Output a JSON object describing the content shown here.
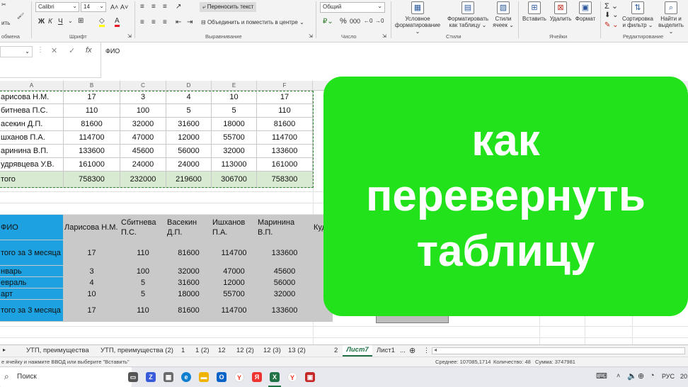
{
  "ribbon": {
    "font_name": "Calibri",
    "font_size": "14",
    "paste_label": "ить",
    "clipboard_group": "обмена",
    "font_group": "Шрифт",
    "bold": "Ж",
    "italic": "К",
    "underline": "Ч",
    "grow_font": "A˄",
    "shrink_font": "A˅",
    "wrap_text": "Переносить текст",
    "merge_center": "Объединить и поместить в центре",
    "alignment_group": "Выравнивание",
    "number_format": "Общий",
    "number_group": "Число",
    "percent": "%",
    "thousands": "000",
    "conditional_format": [
      "Условное",
      "форматирование"
    ],
    "format_as_table": [
      "Форматировать",
      "как таблицу"
    ],
    "cell_styles": [
      "Стили",
      "ячеек"
    ],
    "styles_group": "Стили",
    "insert": "Вставить",
    "delete": "Удалить",
    "format": "Формат",
    "cells_group": "Ячейки",
    "sort_filter": [
      "Сортировка",
      "и фильтр"
    ],
    "find_select": [
      "Найти и",
      "выделить"
    ],
    "editing_group": "Редактирование"
  },
  "formula_bar": {
    "cancel": "✕",
    "confirm": "✓",
    "fx": "fx",
    "content": "ФИО"
  },
  "columns": [
    "A",
    "B",
    "C",
    "D",
    "E",
    "F"
  ],
  "table1": {
    "rows": [
      {
        "name": "арисова Н.М.",
        "values": [
          "17",
          "3",
          "4",
          "10",
          "17"
        ]
      },
      {
        "name": "битнева П.С.",
        "values": [
          "110",
          "100",
          "5",
          "5",
          "110"
        ]
      },
      {
        "name": "асекин Д.П.",
        "values": [
          "81600",
          "32000",
          "31600",
          "18000",
          "81600"
        ]
      },
      {
        "name": "шханов П.А.",
        "values": [
          "114700",
          "47000",
          "12000",
          "55700",
          "114700"
        ]
      },
      {
        "name": "аринина В.П.",
        "values": [
          "133600",
          "45600",
          "56000",
          "32000",
          "133600"
        ]
      },
      {
        "name": "удрявцева У.В.",
        "values": [
          "161000",
          "24000",
          "24000",
          "113000",
          "161000"
        ]
      }
    ],
    "total": {
      "name": "того",
      "values": [
        "758300",
        "232000",
        "219600",
        "306700",
        "758300"
      ]
    }
  },
  "table2": {
    "header": [
      "ФИО",
      "Ларисова Н.М.",
      "Сбитнева П.С.",
      "Васекин Д.П.",
      "Ишханов П.А.",
      "Маринина В.П.",
      "Куд"
    ],
    "rows": [
      {
        "label": "того за 3 месяца",
        "values": [
          "17",
          "110",
          "81600",
          "114700",
          "133600"
        ]
      },
      {
        "label": "нварь",
        "values": [
          "3",
          "100",
          "32000",
          "47000",
          "45600"
        ]
      },
      {
        "label": "евраль",
        "values": [
          "4",
          "5",
          "31600",
          "12000",
          "56000"
        ]
      },
      {
        "label": "арт",
        "values": [
          "10",
          "5",
          "18000",
          "55700",
          "32000"
        ]
      },
      {
        "label": "того за 3 месяца",
        "values": [
          "17",
          "110",
          "81600",
          "114700",
          "133600"
        ]
      }
    ]
  },
  "overlay": {
    "lines": [
      "как",
      "перевернуть",
      "таблицу"
    ],
    "color": "#22e31b"
  },
  "sheet_tabs": [
    "УТП, преимущества",
    "УТП, преимущества (2)",
    "1",
    "1 (2)",
    "12",
    "12 (2)",
    "12 (3)",
    "13 (2)",
    "2",
    "Лист7",
    "Лист1"
  ],
  "active_tab": "Лист7",
  "status": {
    "message": "е ячейку и нажмите ВВОД или выберите \"Вставить\"",
    "average": "Среднее: 107085,1714",
    "count": "Количество: 48",
    "sum": "Сумма: 3747981"
  },
  "taskbar": {
    "search": "Поиск",
    "language": "РУС",
    "time": "20:"
  },
  "colors": {
    "excel_green_total": "#d9ead3",
    "header_blue": "#1da1e0",
    "grey_fill": "#c9c9c9"
  }
}
